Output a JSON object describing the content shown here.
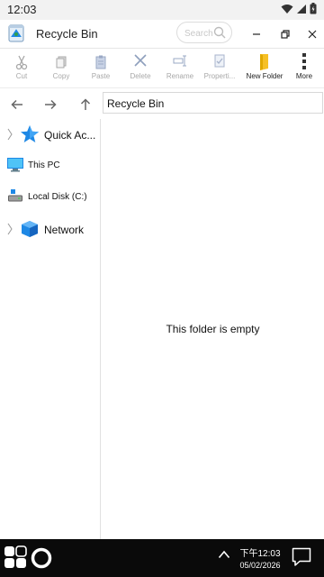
{
  "status_bar": {
    "time": "12:03"
  },
  "window": {
    "title": "Recycle Bin",
    "search_placeholder": "Search"
  },
  "ribbon": {
    "cut": "Cut",
    "copy": "Copy",
    "paste": "Paste",
    "delete": "Delete",
    "rename": "Rename",
    "properties": "Properti...",
    "new_folder": "New Folder",
    "more": "More"
  },
  "address_bar": {
    "path": "Recycle Bin"
  },
  "sidebar": {
    "items": [
      {
        "label": "Quick Ac..."
      },
      {
        "label": "This PC"
      },
      {
        "label": "Local Disk (C:)"
      },
      {
        "label": "Network"
      }
    ]
  },
  "content": {
    "empty_message": "This folder is empty"
  },
  "taskbar": {
    "time": "下午12:03",
    "date": "05/02/2026"
  },
  "colors": {
    "accent_blue": "#1e88e5",
    "folder_yellow": "#f6c026",
    "disabled_gray": "#a8a8a8",
    "taskbar": "#0a0a0a"
  }
}
